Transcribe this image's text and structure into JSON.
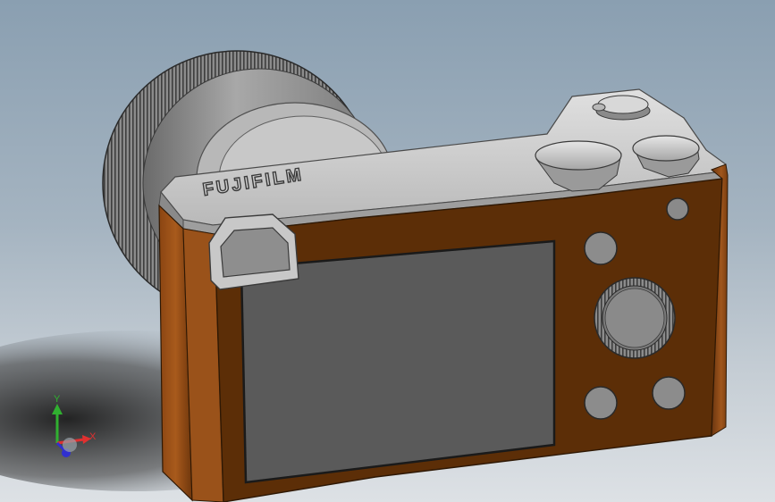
{
  "model": {
    "brand_text": "FUJIFILM",
    "body_color": "#5a2e08",
    "top_plate_color": "#c9c9c9",
    "screen_color": "#5a5a5a",
    "lens_color": "#9a9a9a"
  },
  "triad": {
    "x_label": "X",
    "y_label": "Y",
    "x_color": "#e03030",
    "y_color": "#30b030",
    "z_color": "#3030d0"
  }
}
